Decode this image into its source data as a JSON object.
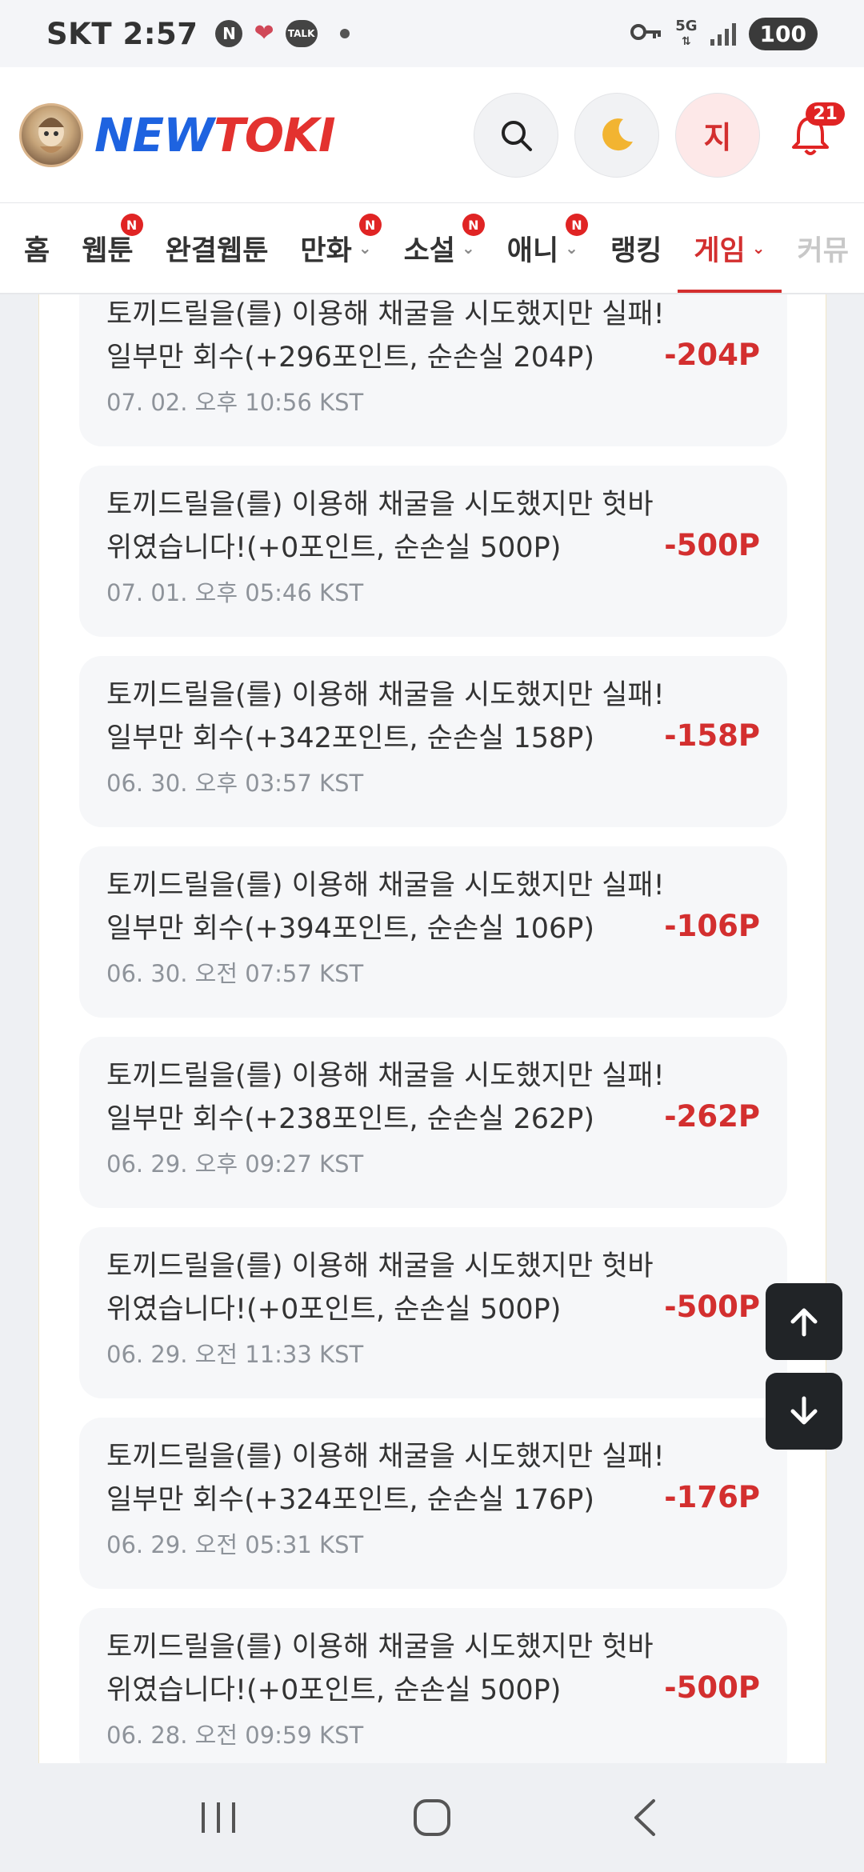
{
  "status_bar": {
    "carrier": "SKT",
    "time": "2:57",
    "icon_n": "N",
    "icon_talk": "TALK",
    "network": "5G",
    "battery": "100"
  },
  "header": {
    "logo_new": "NEW",
    "logo_toki": "TOKI",
    "user_initial": "지",
    "notification_count": "21"
  },
  "nav": {
    "items": [
      {
        "label": "홈"
      },
      {
        "label": "웹툰",
        "badge": "N"
      },
      {
        "label": "완결웹툰"
      },
      {
        "label": "만화",
        "badge": "N"
      },
      {
        "label": "소설",
        "badge": "N"
      },
      {
        "label": "애니",
        "badge": "N"
      },
      {
        "label": "랭킹"
      },
      {
        "label": "게임"
      },
      {
        "label": "커뮤"
      }
    ]
  },
  "history": [
    {
      "msg": "토끼드릴을(를) 이용해 채굴을 시도했지만 실패! 일부만 회수(+296포인트, 순손실 204P)",
      "time": "07. 02. 오후 10:56 KST",
      "amount": "-204P"
    },
    {
      "msg": "토끼드릴을(를) 이용해 채굴을 시도했지만 헛바위였습니다!(+0포인트, 순손실 500P)",
      "time": "07. 01. 오후 05:46 KST",
      "amount": "-500P"
    },
    {
      "msg": "토끼드릴을(를) 이용해 채굴을 시도했지만 실패! 일부만 회수(+342포인트, 순손실 158P)",
      "time": "06. 30. 오후 03:57 KST",
      "amount": "-158P"
    },
    {
      "msg": "토끼드릴을(를) 이용해 채굴을 시도했지만 실패! 일부만 회수(+394포인트, 순손실 106P)",
      "time": "06. 30. 오전 07:57 KST",
      "amount": "-106P"
    },
    {
      "msg": "토끼드릴을(를) 이용해 채굴을 시도했지만 실패! 일부만 회수(+238포인트, 순손실 262P)",
      "time": "06. 29. 오후 09:27 KST",
      "amount": "-262P"
    },
    {
      "msg": "토끼드릴을(를) 이용해 채굴을 시도했지만 헛바위였습니다!(+0포인트, 순손실 500P)",
      "time": "06. 29. 오전 11:33 KST",
      "amount": "-500P"
    },
    {
      "msg": "토끼드릴을(를) 이용해 채굴을 시도했지만 실패! 일부만 회수(+324포인트, 순손실 176P)",
      "time": "06. 29. 오전 05:31 KST",
      "amount": "-176P"
    },
    {
      "msg": "토끼드릴을(를) 이용해 채굴을 시도했지만 헛바위였습니다!(+0포인트, 순손실 500P)",
      "time": "06. 28. 오전 09:59 KST",
      "amount": "-500P"
    }
  ],
  "icons": {
    "search": "search-icon",
    "dark_mode": "moon-icon",
    "notification": "bell-icon",
    "scroll_up": "arrow-up-icon",
    "scroll_down": "arrow-down-icon"
  },
  "colors": {
    "accent": "#d32f2f",
    "logo_blue": "#1e63e0",
    "logo_red": "#e3322f",
    "card_bg": "#f6f7f9",
    "fab_bg": "#212427"
  }
}
